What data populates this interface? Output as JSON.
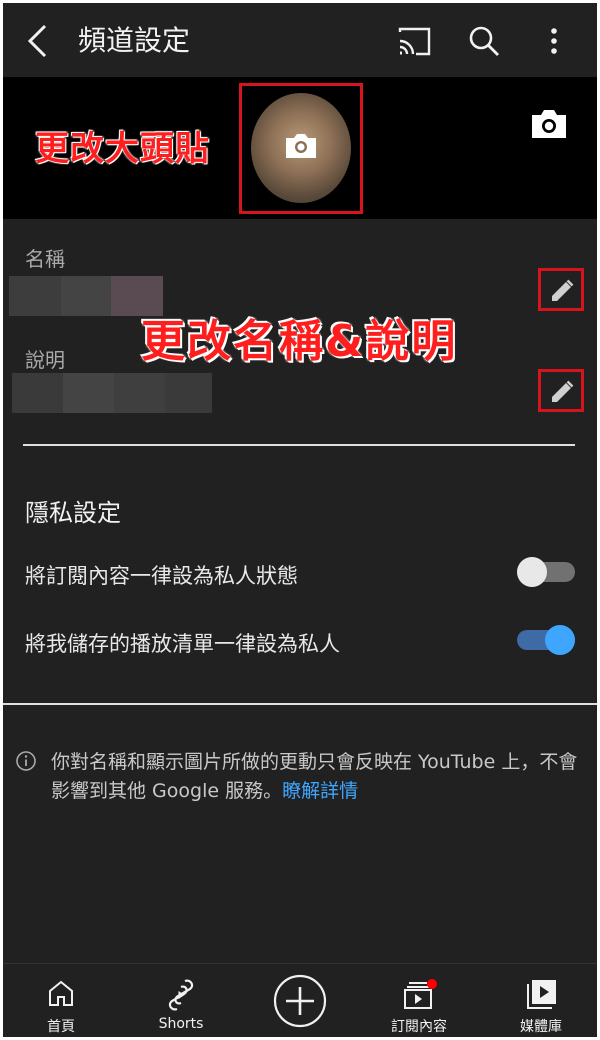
{
  "header": {
    "title": "頻道設定",
    "back_icon": "back-arrow-icon",
    "cast_icon": "cast-icon",
    "search_icon": "search-icon",
    "more_icon": "more-vertical-icon"
  },
  "banner": {
    "annotation": "更改大頭貼",
    "avatar_camera_icon": "camera-icon",
    "banner_camera_icon": "camera-icon"
  },
  "fields": {
    "name_label": "名稱",
    "description_label": "說明",
    "annotation": "更改名稱&說明",
    "edit_icon": "pencil-icon"
  },
  "privacy": {
    "title": "隱私設定",
    "toggles": [
      {
        "label": "將訂閱內容一律設為私人狀態",
        "on": false
      },
      {
        "label": "將我儲存的播放清單一律設為私人",
        "on": true
      }
    ]
  },
  "info": {
    "text": "你對名稱和顯示圖片所做的更動只會反映在 YouTube 上，不會影響到其他 Google 服務。",
    "link": "瞭解詳情"
  },
  "bottom_nav": {
    "items": [
      {
        "label": "首頁",
        "icon": "home-icon"
      },
      {
        "label": "Shorts",
        "icon": "shorts-icon"
      },
      {
        "label": "",
        "icon": "create-plus-icon"
      },
      {
        "label": "訂閱內容",
        "icon": "subscriptions-icon"
      },
      {
        "label": "媒體庫",
        "icon": "library-icon"
      }
    ]
  },
  "colors": {
    "background": "#212121",
    "banner": "#000000",
    "accent_blue": "#3ea6ff",
    "annotation_red": "#ff1e1e",
    "notification_dot": "#ff0000"
  }
}
